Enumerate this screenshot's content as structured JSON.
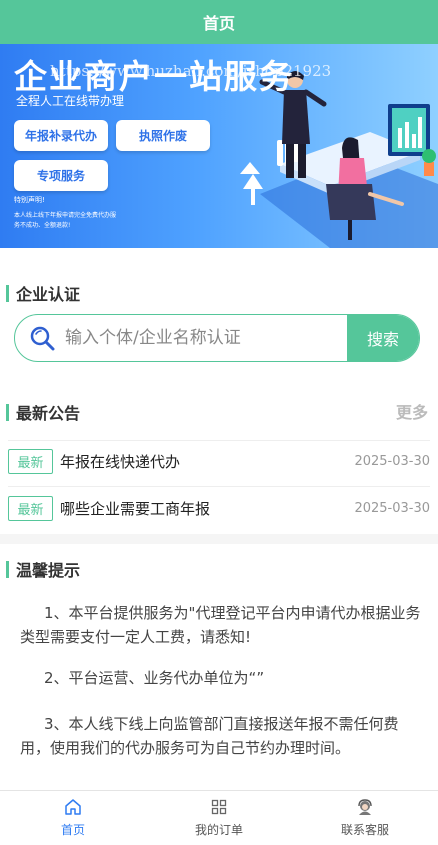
{
  "header": {
    "title": "首页"
  },
  "banner": {
    "headline": "企业商户一站服务",
    "watermark": "https://www.huzhan.com/ishop21923",
    "subtitle": "全程人工在线带办理",
    "buttons": [
      "年报补录代办",
      "执照作废",
      "专项服务"
    ],
    "note_title": "特别声明!",
    "note_text": "本人线上线下年报申请完全免费代办服务不成功、全额退款!"
  },
  "auth": {
    "title": "企业认证",
    "placeholder": "输入个体/企业名称认证",
    "search_label": "搜索"
  },
  "notices": {
    "title": "最新公告",
    "more": "更多",
    "items": [
      {
        "badge": "最新",
        "title": "年报在线快递代办",
        "date": "2025-03-30"
      },
      {
        "badge": "最新",
        "title": "哪些企业需要工商年报",
        "date": "2025-03-30"
      }
    ]
  },
  "tips": {
    "title": "温馨提示",
    "paragraphs": [
      "1、本平台提供服务为\"代理登记平台内申请代办根据业务类型需要支付一定人工费，请悉知!",
      "2、平台运营、业务代办单位为“”",
      "3、本人线下线上向监管部门直接报送年报不需任何费用，使用我们的代办服务可为自己节约办理时间。"
    ]
  },
  "tabbar": {
    "items": [
      {
        "label": "首页",
        "icon": "home-icon",
        "active": true
      },
      {
        "label": "我的订单",
        "icon": "grid-icon",
        "active": false
      },
      {
        "label": "联系客服",
        "icon": "customer-service-icon",
        "active": false
      }
    ]
  },
  "colors": {
    "primary": "#55c69a",
    "tab_active": "#2f7cf2",
    "banner_blue": "#3d8ef5"
  }
}
